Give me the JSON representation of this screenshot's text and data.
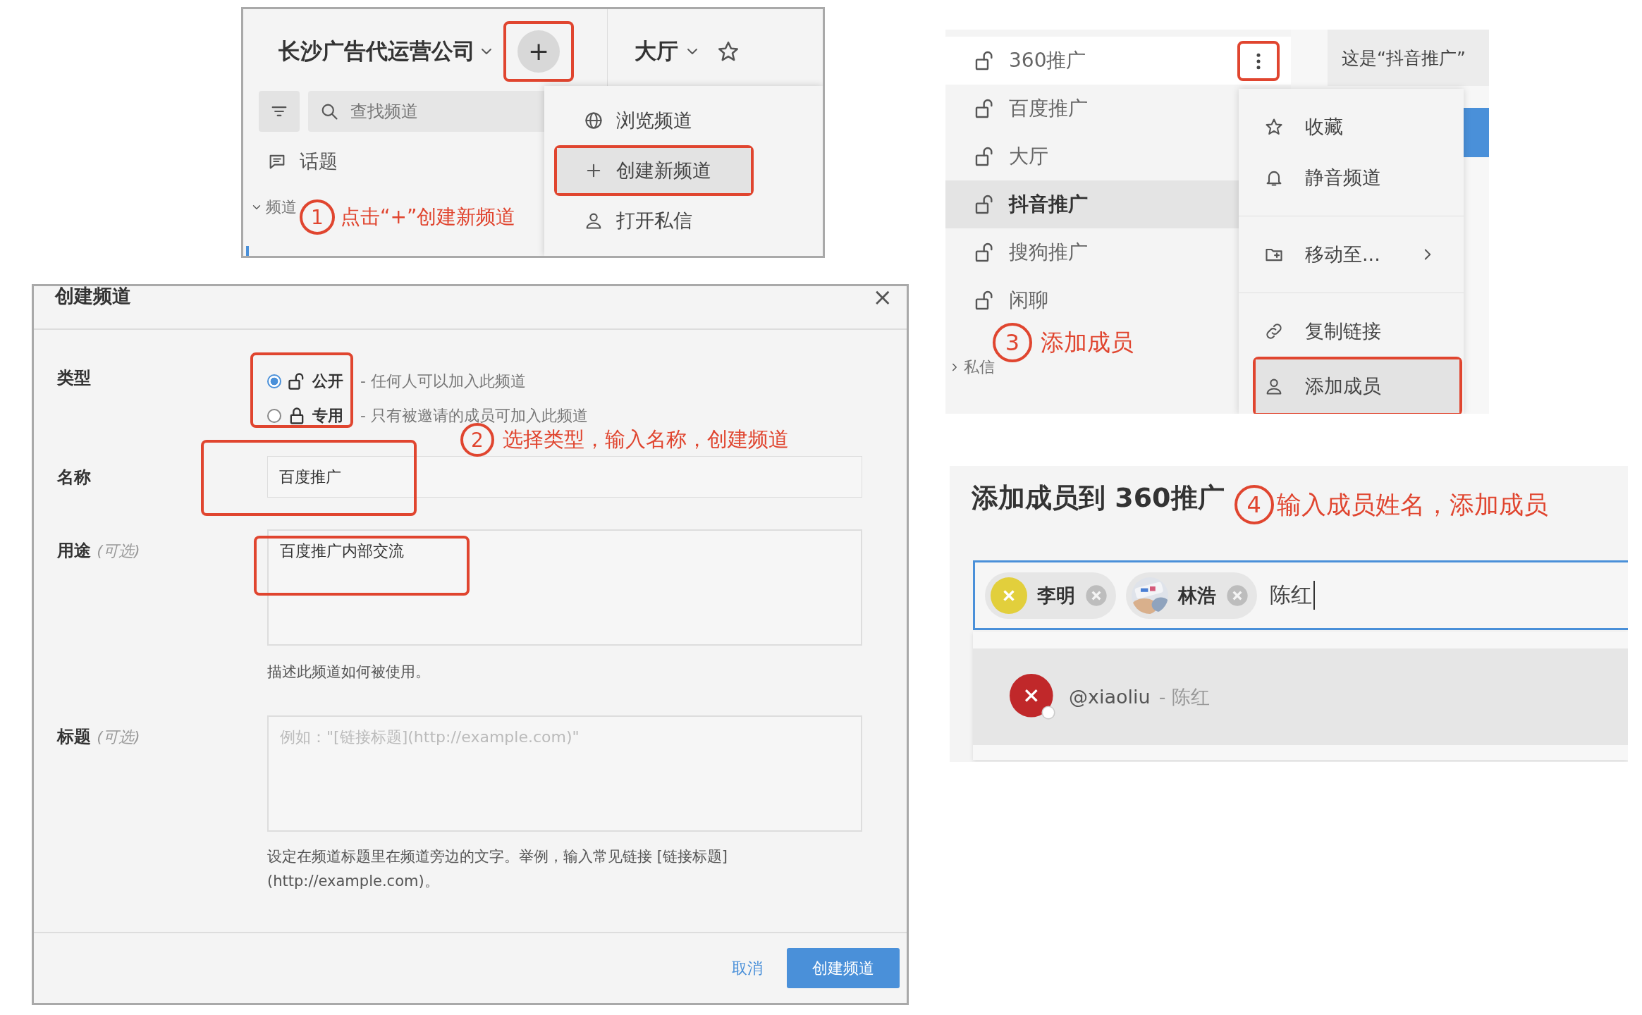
{
  "step1": {
    "team_name": "长沙广告代运营公司",
    "add_button": {
      "label": "+",
      "highlighted": true
    },
    "channel_title": "大厅",
    "search": {
      "placeholder": "查找频道"
    },
    "sidebar_items": [
      {
        "label": "话题"
      }
    ],
    "section": "频道",
    "menu": [
      {
        "label": "浏览频道",
        "kind": "globe",
        "selected": false
      },
      {
        "label": "创建新频道",
        "kind": "plus",
        "selected": true
      },
      {
        "label": "打开私信",
        "kind": "person",
        "selected": false
      }
    ],
    "annotation": {
      "number": "1",
      "text": "点击“+”创建新频道"
    }
  },
  "step2": {
    "title": "创建频道",
    "close": "×",
    "type_label": "类型",
    "type_options": [
      {
        "kind": "public",
        "label": "公开",
        "description": "- 任何人可以加入此频道",
        "selected": true
      },
      {
        "kind": "private",
        "label": "专用",
        "description": "- 只有被邀请的成员可加入此频道",
        "selected": false
      }
    ],
    "name_label": "名称",
    "name_value": "百度推广",
    "purpose_label": "用途",
    "purpose_optional": "(可选)",
    "purpose_value": "百度推广内部交流",
    "purpose_help": "描述此频道如何被使用。",
    "header_label": "标题",
    "header_optional": "(可选)",
    "header_placeholder": "例如：\"[链接标题](http://example.com)\"",
    "header_help": "设定在频道标题里在频道旁边的文字。举例，输入常见链接 [链接标题](http://example.com)。",
    "cancel": "取消",
    "submit": "创建频道",
    "annotation": {
      "number": "2",
      "text": "选择类型，输入名称，创建频道"
    }
  },
  "step3": {
    "channels": [
      {
        "name": "360推广",
        "hovered": true,
        "selected": false
      },
      {
        "name": "百度推广",
        "hovered": false,
        "selected": false
      },
      {
        "name": "大厅",
        "hovered": false,
        "selected": false
      },
      {
        "name": "抖音推广",
        "hovered": false,
        "selected": true
      },
      {
        "name": "搜狗推广",
        "hovered": false,
        "selected": false
      },
      {
        "name": "闲聊",
        "hovered": false,
        "selected": false
      }
    ],
    "section": "私信",
    "header_text": "这是“抖音推广”",
    "menu_groups": [
      {
        "items": [
          {
            "label": "收藏",
            "kind": "star",
            "submenu": false,
            "selected": false
          },
          {
            "label": "静音频道",
            "kind": "bell",
            "submenu": false,
            "selected": false
          }
        ]
      },
      {
        "items": [
          {
            "label": "移动至...",
            "kind": "folder",
            "submenu": true,
            "selected": false
          }
        ]
      },
      {
        "items": [
          {
            "label": "复制链接",
            "kind": "link",
            "submenu": false,
            "selected": false
          },
          {
            "label": "添加成员",
            "kind": "person",
            "submenu": false,
            "selected": true
          }
        ]
      }
    ],
    "annotation": {
      "number": "3",
      "text": "添加成员"
    }
  },
  "step4": {
    "title": "添加成员到 360推广",
    "chips": [
      {
        "name": "李明",
        "kind": "initial",
        "color": "#e2cf3c"
      },
      {
        "name": "林浩",
        "kind": "picture"
      }
    ],
    "typed": "陈红",
    "suggestions": [
      {
        "handle": "@xiaoliu",
        "name": "- 陈红",
        "color": "#c0282a",
        "selected": true
      }
    ],
    "annotation": {
      "number": "4",
      "text": "输入成员姓名，添加成员"
    }
  }
}
